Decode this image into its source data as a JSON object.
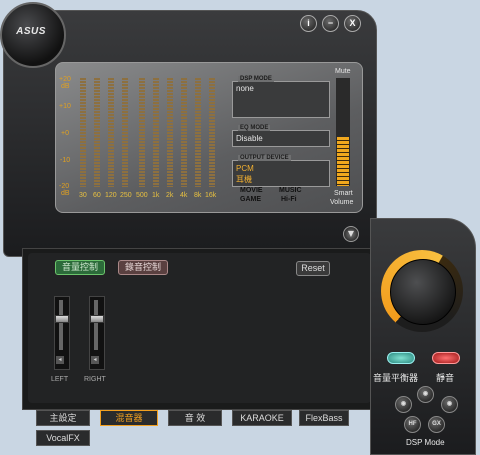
{
  "brand": {
    "logo": "ASUS"
  },
  "window_controls": {
    "info": "i",
    "minimize": "−",
    "close": "X"
  },
  "eq": {
    "db_labels": [
      "+20",
      "dB",
      "+10",
      "+0",
      "-10",
      "-20",
      "dB"
    ],
    "freq_labels": [
      "30",
      "60",
      "120",
      "250",
      "500",
      "1k",
      "2k",
      "4k",
      "8k",
      "16k"
    ]
  },
  "dsp_mode": {
    "title": "DSP MODE",
    "value": "none"
  },
  "eq_mode": {
    "title": "EQ MODE",
    "value": "Disable"
  },
  "output_device": {
    "title": "OUTPUT DEVICE",
    "line1": "PCM",
    "line2": "耳機"
  },
  "mode_labels": {
    "movie": "MOVIE",
    "music": "MUSIC",
    "game": "GAME",
    "hifi": "Hi-Fi"
  },
  "volume": {
    "mute_label": "Mute",
    "smart_label_1": "Smart",
    "smart_label_2": "Volume",
    "level": 0.45
  },
  "mixer": {
    "playback_tab": "音量控制",
    "record_tab": "錄音控制",
    "reset": "Reset",
    "channels": [
      "LEFT",
      "RIGHT"
    ]
  },
  "bottom_tabs": [
    "主設定",
    "混音器",
    "音 效",
    "KARAOKE",
    "FlexBass",
    "VocalFX"
  ],
  "right": {
    "balance_label": "音量平衡器",
    "mute_label": "靜音",
    "dsp_mode_label": "DSP Mode",
    "hf": "HF",
    "gx": "GX"
  },
  "colors": {
    "accent": "#f29b1c",
    "eq_text": "#e0a020",
    "green_btn": "#3aa85a",
    "red_btn": "#c23030"
  }
}
